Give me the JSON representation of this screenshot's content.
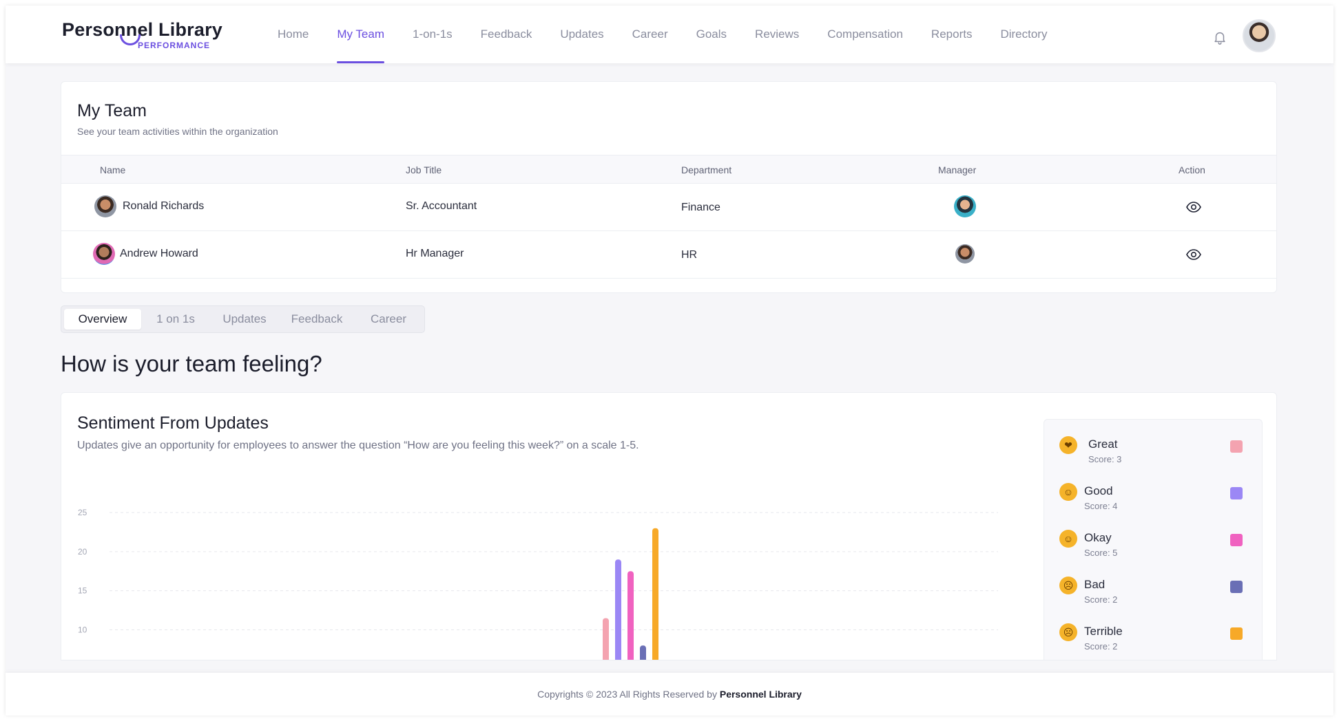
{
  "brand": {
    "name_part1": "Perso",
    "name_nn": "nn",
    "name_part2": "el Library",
    "sub": "PERFORMANCE"
  },
  "nav": {
    "items": [
      {
        "label": "Home",
        "active": false
      },
      {
        "label": "My Team",
        "active": true
      },
      {
        "label": "1-on-1s",
        "active": false
      },
      {
        "label": "Feedback",
        "active": false
      },
      {
        "label": "Updates",
        "active": false
      },
      {
        "label": "Career",
        "active": false
      },
      {
        "label": "Goals",
        "active": false
      },
      {
        "label": "Reviews",
        "active": false
      },
      {
        "label": "Compensation",
        "active": false
      },
      {
        "label": "Reports",
        "active": false
      },
      {
        "label": "Directory",
        "active": false
      }
    ],
    "icons": {
      "notifications": "bell-icon",
      "profile": "user-avatar"
    }
  },
  "team": {
    "title": "My Team",
    "subtitle": "See your team activities within the organization",
    "columns": {
      "name": "Name",
      "job_title": "Job Title",
      "department": "Department",
      "manager": "Manager",
      "action": "Action"
    },
    "rows": [
      {
        "name": "Ronald Richards",
        "job_title": "Sr. Accountant",
        "department": "Finance",
        "action_icon": "eye-icon"
      },
      {
        "name": "Andrew Howard",
        "job_title": "Hr Manager",
        "department": "HR",
        "action_icon": "eye-icon"
      }
    ]
  },
  "tabs": [
    {
      "label": "Overview",
      "active": true
    },
    {
      "label": "1 on 1s",
      "active": false
    },
    {
      "label": "Updates",
      "active": false
    },
    {
      "label": "Feedback",
      "active": false
    },
    {
      "label": "Career",
      "active": false
    }
  ],
  "section_title": "How is your team feeling?",
  "sentiment": {
    "title": "Sentiment From Updates",
    "subtitle": "Updates give an opportunity for employees to answer the question “How are you feeling this week?” on a scale 1-5.",
    "legend": [
      {
        "label": "Great",
        "score": "Score: 3",
        "color": "#f4a3b0",
        "emoji": "heart-eyes-emoji-icon"
      },
      {
        "label": "Good",
        "score": "Score: 4",
        "color": "#9b87f5",
        "emoji": "grinning-emoji-icon"
      },
      {
        "label": "Okay",
        "score": "Score: 5",
        "color": "#f062c0",
        "emoji": "smiling-emoji-icon"
      },
      {
        "label": "Bad",
        "score": "Score: 2",
        "color": "#6a6fb5",
        "emoji": "frowning-emoji-icon"
      },
      {
        "label": "Terrible",
        "score": "Score: 2",
        "color": "#f7a928",
        "emoji": "tired-emoji-icon"
      }
    ]
  },
  "chart_data": {
    "type": "bar",
    "yticks": [
      25,
      20,
      15,
      10
    ],
    "ylim": [
      6,
      25
    ],
    "grid": true,
    "series": [
      {
        "name": "Great",
        "value": 11.5,
        "color": "#f4a3b0"
      },
      {
        "name": "Good",
        "value": 19,
        "color": "#9b87f5"
      },
      {
        "name": "Okay",
        "value": 17.5,
        "color": "#f062c0"
      },
      {
        "name": "Bad",
        "value": 8,
        "color": "#6a6fb5"
      },
      {
        "name": "Terrible",
        "value": 23,
        "color": "#f7a928"
      }
    ]
  },
  "footer": {
    "text": "Copyrights © 2023 All Rights Reserved by ",
    "brand": "Personnel Library"
  }
}
